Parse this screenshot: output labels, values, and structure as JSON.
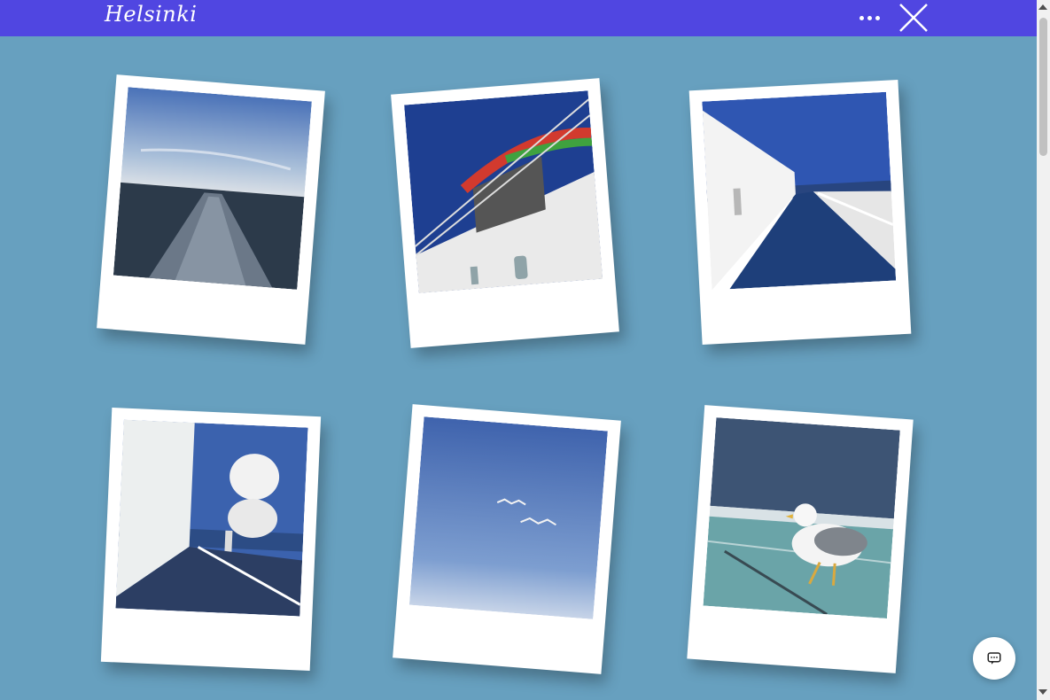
{
  "header": {
    "brand": "Helsinki",
    "icons": {
      "more": "more-dots-icon",
      "close": "close-x-icon"
    }
  },
  "gallery": {
    "photos": [
      {
        "name": "photo-sea-wake",
        "subject": "sea-wake"
      },
      {
        "name": "photo-ship-funnel",
        "subject": "ship-superstructure"
      },
      {
        "name": "photo-ship-deck",
        "subject": "ship-deck"
      },
      {
        "name": "photo-lifeboats",
        "subject": "lifeboat-deck"
      },
      {
        "name": "photo-seagulls-sky",
        "subject": "seagulls-flying"
      },
      {
        "name": "photo-seagull-railing",
        "subject": "seagull"
      }
    ]
  },
  "chat": {
    "icon": "chat-bubble-icon"
  },
  "colors": {
    "header": "#5046e1",
    "background": "#67a0bf",
    "card": "#ffffff",
    "scroll_track": "#f1f1f1",
    "scroll_thumb": "#c1c1c1"
  }
}
